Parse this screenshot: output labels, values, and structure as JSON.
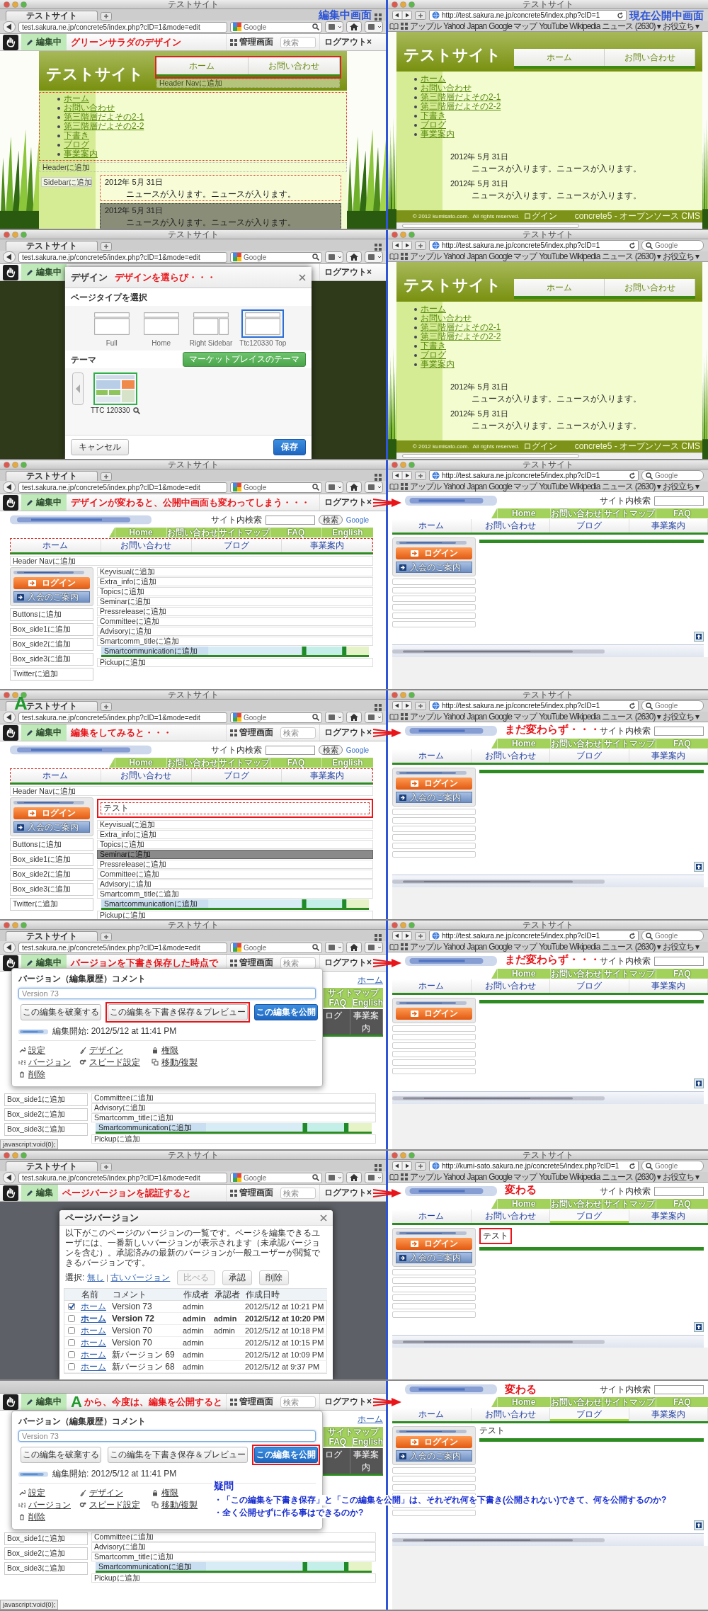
{
  "rows": [
    {
      "arrow": false,
      "left": {
        "corner_label": "編集中画面",
        "chrome": {
          "title": "テストサイト",
          "tab": "テストサイト",
          "url": "test.sakura.ne.jp/concrete5/index.php?cID=1&mode=edit",
          "search": "Google"
        },
        "toolbar": {
          "edit_label": "編集中",
          "annotation": "グリーンサラダのデザイン",
          "admin": "管理画面",
          "search_placeholder": "検索",
          "logout": "ログアウト×"
        },
        "content": {
          "kind": "green_edit",
          "title": "テストサイト",
          "nav": [
            "ホーム",
            "お問い合わせ"
          ],
          "nav_add": "Header Navに追加",
          "links": [
            "ホーム",
            "お問い合わせ",
            "第三階層だよその2-1",
            "第三階層だよその2-2",
            "下書き",
            "ブログ",
            "事業案内"
          ],
          "header_add": "Headerに追加",
          "sidebar_add": "Sidebarに追加",
          "news": [
            {
              "date": "2012年 5月 31日",
              "text": "ニュースが入ります。ニュースが入ります。",
              "kind": "outlined"
            },
            {
              "date": "2012年 5月 31日",
              "text": "ニュースが入ります。ニュースが入ります。",
              "kind": "hover"
            }
          ]
        }
      },
      "right": {
        "corner_label": "現在公開中画面",
        "chrome": {
          "title": "テストサイト",
          "url": "http://test.sakura.ne.jp/concrete5/index.php?cID=1",
          "bookmarks": [
            "アップル",
            "Yahoo! Japan",
            "Google マップ",
            "YouTube",
            "Wikipedia",
            "ニュース (2630) ▾",
            "お役立ち ▾"
          ]
        },
        "content": {
          "kind": "green_public",
          "title": "テストサイト",
          "nav": [
            "ホーム",
            "お問い合わせ"
          ],
          "links": [
            "ホーム",
            "お問い合わせ",
            "第三階層だよその2-1",
            "第三階層だよその2-2",
            "下書き",
            "ブログ",
            "事業案内"
          ],
          "news": [
            {
              "date": "2012年 5月 31日",
              "text": "ニュースが入ります。ニュースが入ります。"
            },
            {
              "date": "2012年 5月 31日",
              "text": "ニュースが入ります。ニュースが入ります。"
            }
          ],
          "footer": {
            "copyright": "© 2012 kumisato.com.",
            "rights": "All rights reserved.",
            "login": "ログイン",
            "cms": "concrete5 - オープンソース CMS"
          }
        }
      }
    },
    {
      "arrow": false,
      "left": {
        "chrome": {
          "title": "テストサイト",
          "tab": "テストサイト",
          "url": "test.sakura.ne.jp/concrete5/index.php?cID=1&mode=edit",
          "search": "Google"
        },
        "toolbar": {
          "edit_label": "編集中",
          "logout": "ログアウト×"
        },
        "content": {
          "kind": "design_dialog",
          "title": "デザイン",
          "annotation": "デザインを選らび・・・",
          "page_type_heading": "ページタイプを選択",
          "page_types": [
            {
              "label": "Full",
              "selected": false
            },
            {
              "label": "Home",
              "selected": false
            },
            {
              "label": "Right Sidebar",
              "selected": false
            },
            {
              "label": "Ttc120330 Top",
              "selected": true
            }
          ],
          "theme_heading": "テーマ",
          "market_button": "マーケットプレイスのテーマ",
          "themes": [
            {
              "label": "TTC 120330",
              "selected": true
            }
          ],
          "cancel": "キャンセル",
          "save": "保存"
        }
      },
      "right": {
        "chrome": {
          "title": "テストサイト",
          "url": "http://test.sakura.ne.jp/concrete5/index.php?cID=1",
          "search": "Google",
          "bookmarks": [
            "アップル",
            "Yahoo! Japan",
            "Google マップ",
            "YouTube",
            "Wikipedia",
            "ニュース (2630) ▾",
            "お役立ち ▾"
          ]
        },
        "content": {
          "kind": "green_public",
          "title": "テストサイト",
          "nav": [
            "ホーム",
            "お問い合わせ"
          ],
          "links": [
            "ホーム",
            "お問い合わせ",
            "第三階層だよその2-1",
            "第三階層だよその2-2",
            "下書き",
            "ブログ",
            "事業案内"
          ],
          "news": [
            {
              "date": "2012年 5月 31日",
              "text": "ニュースが入ります。ニュースが入ります。"
            },
            {
              "date": "2012年 5月 31日",
              "text": "ニュースが入ります。ニュースが入ります。"
            }
          ],
          "footer": {
            "copyright": "© 2012 kumisato.com.",
            "rights": "All rights reserved.",
            "login": "ログイン",
            "cms": "concrete5 - オープンソース CMS"
          }
        }
      }
    },
    {
      "arrow": true,
      "left": {
        "chrome": {
          "title": "テストサイト",
          "tab": "テストサイト",
          "url": "test.sakura.ne.jp/concrete5/index.php?cID=1&mode=edit",
          "search": "Google"
        },
        "toolbar": {
          "edit_label": "編集中",
          "annotation": "デザインが変わると、公開中画面も変わってしまう・・・",
          "logout": "ログアウト×"
        },
        "content": {
          "kind": "ttc_edit",
          "search_label": "サイト内検索",
          "search_button": "検索",
          "google": "Google",
          "tabs": [
            "Home",
            "お問い合わせ",
            "サイトマップ",
            "FAQ",
            "English"
          ],
          "nav": [
            "ホーム",
            "お問い合わせ",
            "ブログ",
            "事業案内"
          ],
          "nav_add": "Header Navに追加",
          "login": "ログイン",
          "join": "入会のご案内",
          "side_areas": [
            "Buttonsに追加",
            "Box_side1に追加",
            "Box_side2に追加",
            "Box_side3に追加",
            "Twitterに追加"
          ],
          "main_areas": [
            {
              "label": "Keyvisualに追加",
              "kind": "area"
            },
            {
              "label": "Extra_infoに追加",
              "kind": "area"
            },
            {
              "label": "Topicsに追加",
              "kind": "area"
            },
            {
              "label": "Seminarに追加",
              "kind": "area"
            },
            {
              "label": "Pressreleaseに追加",
              "kind": "area"
            },
            {
              "label": "Committeeに追加",
              "kind": "area"
            },
            {
              "label": "Advisoryに追加",
              "kind": "area"
            },
            {
              "label": "Smartcomm_titleに追加",
              "kind": "area"
            },
            {
              "label": "Smartcommunicationに追加",
              "kind": "banner"
            },
            {
              "label": "Pickupに追加",
              "kind": "area"
            }
          ]
        }
      },
      "right": {
        "chrome": {
          "title": "テストサイト",
          "url": "http://test.sakura.ne.jp/concrete5/index.php?cID=1",
          "search": "Google",
          "bookmarks": [
            "アップル",
            "Yahoo! Japan",
            "Google マップ",
            "YouTube",
            "Wikipedia",
            "ニュース (2630) ▾",
            "お役立ち ▾"
          ]
        },
        "content": {
          "kind": "ttc_public",
          "search_label": "サイト内検索",
          "tabs": [
            "Home",
            "お問い合わせ",
            "サイトマップ",
            "FAQ"
          ],
          "nav": [
            {
              "label": "ホーム",
              "selected": false
            },
            {
              "label": "お問い合わせ",
              "selected": false
            },
            {
              "label": "ブログ",
              "selected": false
            },
            {
              "label": "事業案内",
              "selected": false
            }
          ],
          "login": "ログイン",
          "join": "入会のご案内"
        }
      }
    },
    {
      "arrow": true,
      "left": {
        "chrome": {
          "title": "テストサイト",
          "tab": "テストサイト",
          "tab_mark": "A",
          "url": "test.sakura.ne.jp/concrete5/index.php?cID=1&mode=edit",
          "search": "Google"
        },
        "toolbar": {
          "edit_label": "編集中",
          "annotation": "編集をしてみると・・・",
          "admin": "管理画面",
          "search_placeholder": "検索",
          "logout": "ログアウト×"
        },
        "content": {
          "kind": "ttc_edit",
          "search_label": "サイト内検索",
          "search_button": "検索",
          "google": "Google",
          "tabs": [
            "Home",
            "お問い合わせ",
            "サイトマップ",
            "FAQ",
            "English"
          ],
          "nav": [
            "ホーム",
            "お問い合わせ",
            "ブログ",
            "事業案内"
          ],
          "nav_add": "Header Navに追加",
          "login": "ログイン",
          "join": "入会のご案内",
          "side_areas": [
            "Buttonsに追加",
            "Box_side1に追加",
            "Box_side2に追加",
            "Box_side3に追加",
            "Twitterに追加"
          ],
          "main_areas": [
            {
              "label": "テスト",
              "kind": "content"
            },
            {
              "label": "Keyvisualに追加",
              "kind": "area"
            },
            {
              "label": "Extra_infoに追加",
              "kind": "area"
            },
            {
              "label": "Topicsに追加",
              "kind": "area"
            },
            {
              "label": "Seminarに追加",
              "kind": "hover"
            },
            {
              "label": "Pressreleaseに追加",
              "kind": "area"
            },
            {
              "label": "Committeeに追加",
              "kind": "area"
            },
            {
              "label": "Advisoryに追加",
              "kind": "area"
            },
            {
              "label": "Smartcomm_titleに追加",
              "kind": "area"
            },
            {
              "label": "Smartcommunicationに追加",
              "kind": "banner"
            },
            {
              "label": "Pickupに追加",
              "kind": "area"
            }
          ]
        }
      },
      "right": {
        "annotation": "まだ変わらず・・・",
        "chrome": {
          "title": "テストサイト",
          "url": "http://test.sakura.ne.jp/concrete5/index.php?cID=1",
          "search": "Google",
          "bookmarks": [
            "アップル",
            "Yahoo! Japan",
            "Google マップ",
            "YouTube",
            "Wikipedia",
            "ニュース (2630) ▾",
            "お役立ち ▾"
          ]
        },
        "content": {
          "kind": "ttc_public",
          "search_label": "サイト内検索",
          "tabs": [
            "Home",
            "お問い合わせ",
            "サイトマップ",
            "FAQ"
          ],
          "nav": [
            {
              "label": "ホーム",
              "selected": false
            },
            {
              "label": "お問い合わせ",
              "selected": false
            },
            {
              "label": "ブログ",
              "selected": false
            },
            {
              "label": "事業案内",
              "selected": false
            }
          ],
          "login": "ログイン",
          "join": "入会のご案内"
        }
      }
    },
    {
      "arrow": true,
      "left": {
        "status": "javascript:void(0);",
        "chrome": {
          "title": "テストサイト",
          "tab": "テストサイト",
          "url": "test.sakura.ne.jp/concrete5/index.php?cID=1&mode=edit",
          "search": "Google"
        },
        "toolbar": {
          "edit_label": "編集中",
          "annotation": "バージョンを下書き保存した時点で",
          "admin": "管理画面",
          "search_placeholder": "検索",
          "logout": "ログアウト×"
        },
        "content": {
          "kind": "version_popup",
          "heading": "バージョン（編集履歴）コメント",
          "comment_placeholder": "Version 73",
          "buttons": [
            {
              "label": "この編集を破棄する",
              "kind": "default",
              "circled": false
            },
            {
              "label": "この編集を下書き保存＆プレビュー",
              "kind": "default",
              "circled": true
            },
            {
              "label": "この編集を公開",
              "kind": "primary",
              "circled": false
            }
          ],
          "started": "編集開始: 2012/5/12 at 11:41 PM",
          "menu": [
            [
              "設定",
              "バージョン",
              "削除"
            ],
            [
              "デザイン",
              "スピード設定"
            ],
            [
              "権限",
              "移動/複製"
            ]
          ],
          "home_link": "ホーム",
          "tabs": [
            "サイトマップ",
            "FAQ",
            "English"
          ],
          "nav": [
            "ログ",
            "事業案内"
          ],
          "side_areas": [
            "Box_side1に追加",
            "Box_side2に追加",
            "Box_side3に追加"
          ],
          "main_areas": [
            {
              "label": "Committeeに追加",
              "kind": "area"
            },
            {
              "label": "Advisoryに追加",
              "kind": "area"
            },
            {
              "label": "Smartcomm_titleに追加",
              "kind": "area"
            },
            {
              "label": "Smartcommunicationに追加",
              "kind": "banner"
            },
            {
              "label": "Pickupに追加",
              "kind": "area"
            }
          ]
        }
      },
      "right": {
        "annotation": "まだ変わらず・・・",
        "chrome": {
          "title": "テストサイト",
          "url": "http://test.sakura.ne.jp/concrete5/index.php?cID=1",
          "search": "Google",
          "bookmarks": [
            "アップル",
            "Yahoo! Japan",
            "Google マップ",
            "YouTube",
            "Wikipedia",
            "ニュース (2630) ▾",
            "お役立ち ▾"
          ]
        },
        "content": {
          "kind": "ttc_public",
          "search_label": "サイト内検索",
          "tabs": [
            "Home",
            "お問い合わせ",
            "サイトマップ",
            "FAQ"
          ],
          "nav": [
            {
              "label": "ホーム",
              "selected": false
            },
            {
              "label": "お問い合わせ",
              "selected": false
            },
            {
              "label": "ブログ",
              "selected": false
            },
            {
              "label": "事業案内",
              "selected": false
            }
          ],
          "login": "ログイン"
        }
      }
    },
    {
      "arrow": true,
      "left": {
        "chrome": {
          "title": "テストサイト",
          "tab": "テストサイト",
          "url": "test.sakura.ne.jp/concrete5/index.php?cID=1&mode=edit",
          "search": "Google"
        },
        "toolbar": {
          "edit_label": "編集",
          "annotation": "ページバージョンを認証すると",
          "admin": "管理画面",
          "search_placeholder": "検索",
          "logout": "ログアウト×"
        },
        "content": {
          "kind": "versions_dialog",
          "title": "ページバージョン",
          "description": "以下がこのページのバージョンの一覧です。ページを編集できるユーザには、一番新しいバージョンが表示されます（未承認バージョンを含む）。承認済みの最新のバージョンが一般ユーザーが閲覧できるバージョンです。",
          "select_label": "選択:",
          "select_links": [
            "無し",
            "古いバージョン"
          ],
          "actions": [
            {
              "label": "比べる",
              "disabled": true
            },
            {
              "label": "承認",
              "disabled": false
            },
            {
              "label": "削除",
              "disabled": false
            }
          ],
          "columns": [
            "名前",
            "コメント",
            "作成者",
            "承認者",
            "作成日時"
          ],
          "versions": [
            {
              "checked": true,
              "approved": false,
              "name": "ホーム",
              "comment": "Version 73",
              "creator": "admin",
              "date": "2012/5/12 at 10:21 PM"
            },
            {
              "checked": false,
              "approved": true,
              "name": "ホーム",
              "comment": "Version 72",
              "creator": "admin",
              "approver": "admin",
              "date": "2012/5/12 at 10:20 PM"
            },
            {
              "checked": false,
              "approved": false,
              "name": "ホーム",
              "comment": "Version 70",
              "creator": "admin",
              "approver": "admin",
              "date": "2012/5/12 at 10:18 PM"
            },
            {
              "checked": false,
              "approved": false,
              "name": "ホーム",
              "comment": "Version 70",
              "creator": "admin",
              "date": "2012/5/12 at 10:15 PM"
            },
            {
              "checked": false,
              "approved": false,
              "name": "ホーム",
              "comment": "新バージョン 69",
              "creator": "admin",
              "date": "2012/5/12 at 10:09 PM"
            },
            {
              "checked": false,
              "approved": false,
              "name": "ホーム",
              "comment": "新バージョン 68",
              "creator": "admin",
              "date": "2012/5/12 at 9:37 PM"
            }
          ]
        }
      },
      "right": {
        "annotation": "変わる",
        "chrome": {
          "title": "テストサイト",
          "url": "http://kumi-sato.sakura.ne.jp/concrete5/index.php?cID=1",
          "search": "Google",
          "bookmarks": [
            "アップル",
            "Yahoo! Japan",
            "Google マップ",
            "YouTube",
            "Wikipedia",
            "ニュース (2630) ▾",
            "お役立ち ▾"
          ]
        },
        "content": {
          "kind": "ttc_public",
          "search_label": "サイト内検索",
          "tabs": [
            "Home",
            "お問い合わせ",
            "サイトマップ",
            "FAQ"
          ],
          "nav": [
            {
              "label": "ホーム",
              "selected": false
            },
            {
              "label": "お問い合わせ",
              "selected": false
            },
            {
              "label": "ブログ",
              "selected": true
            },
            {
              "label": "事業案内",
              "selected": false
            }
          ],
          "login": "ログイン",
          "join": "入会のご案内",
          "text": {
            "label": "テスト",
            "circled": true
          }
        }
      }
    },
    {
      "arrow": true,
      "question": {
        "title": "疑問",
        "lines": [
          "・「この編集を下書き保存」と「この編集を公開」は、それぞれ何を下書き(公開されない)できて、何を公開するのか?",
          "・全く公開せずに作る事はできるのか?"
        ]
      },
      "left": {
        "status": "javascript:void(0);",
        "toolbar": {
          "edit_label": "編集中",
          "annotation_mark": "A",
          "annotation": "から、今度は、編集を公開すると",
          "admin": "管理画面",
          "search_placeholder": "検索",
          "logout": "ログアウト×"
        },
        "content": {
          "kind": "version_popup",
          "heading": "バージョン（編集履歴）コメント",
          "comment_placeholder": "Version 73",
          "buttons": [
            {
              "label": "この編集を破棄する",
              "kind": "default",
              "circled": false
            },
            {
              "label": "この編集を下書き保存＆プレビュー",
              "kind": "default",
              "circled": false
            },
            {
              "label": "この編集を公開",
              "kind": "primary",
              "circled": true
            }
          ],
          "started": "編集開始: 2012/5/12 at 11:41 PM",
          "menu": [
            [
              "設定",
              "バージョン",
              "削除"
            ],
            [
              "デザイン",
              "スピード設定"
            ],
            [
              "権限",
              "移動/複製"
            ]
          ],
          "home_link": "ホーム",
          "tabs": [
            "サイトマップ",
            "FAQ",
            "English"
          ],
          "nav": [
            "ログ",
            "事業案内"
          ],
          "side_areas": [
            "Box_side1に追加",
            "Box_side2に追加",
            "Box_side3に追加"
          ],
          "main_areas": [
            {
              "label": "Committeeに追加",
              "kind": "area"
            },
            {
              "label": "Advisoryに追加",
              "kind": "area"
            },
            {
              "label": "Smartcomm_titleに追加",
              "kind": "area"
            },
            {
              "label": "Smartcommunicationに追加",
              "kind": "banner"
            },
            {
              "label": "Pickupに追加",
              "kind": "area"
            }
          ]
        }
      },
      "right": {
        "annotation": "変わる",
        "content": {
          "kind": "ttc_public",
          "search_label": "サイト内検索",
          "tabs": [
            "Home",
            "お問い合わせ",
            "サイトマップ",
            "FAQ"
          ],
          "nav": [
            {
              "label": "ホーム",
              "selected": false
            },
            {
              "label": "お問い合わせ",
              "selected": false
            },
            {
              "label": "ブログ",
              "selected": true
            },
            {
              "label": "事業案内",
              "selected": false
            }
          ],
          "login": "ログイン",
          "join": "入会のご案内",
          "text": {
            "label": "テスト",
            "circled": false
          }
        }
      }
    }
  ]
}
